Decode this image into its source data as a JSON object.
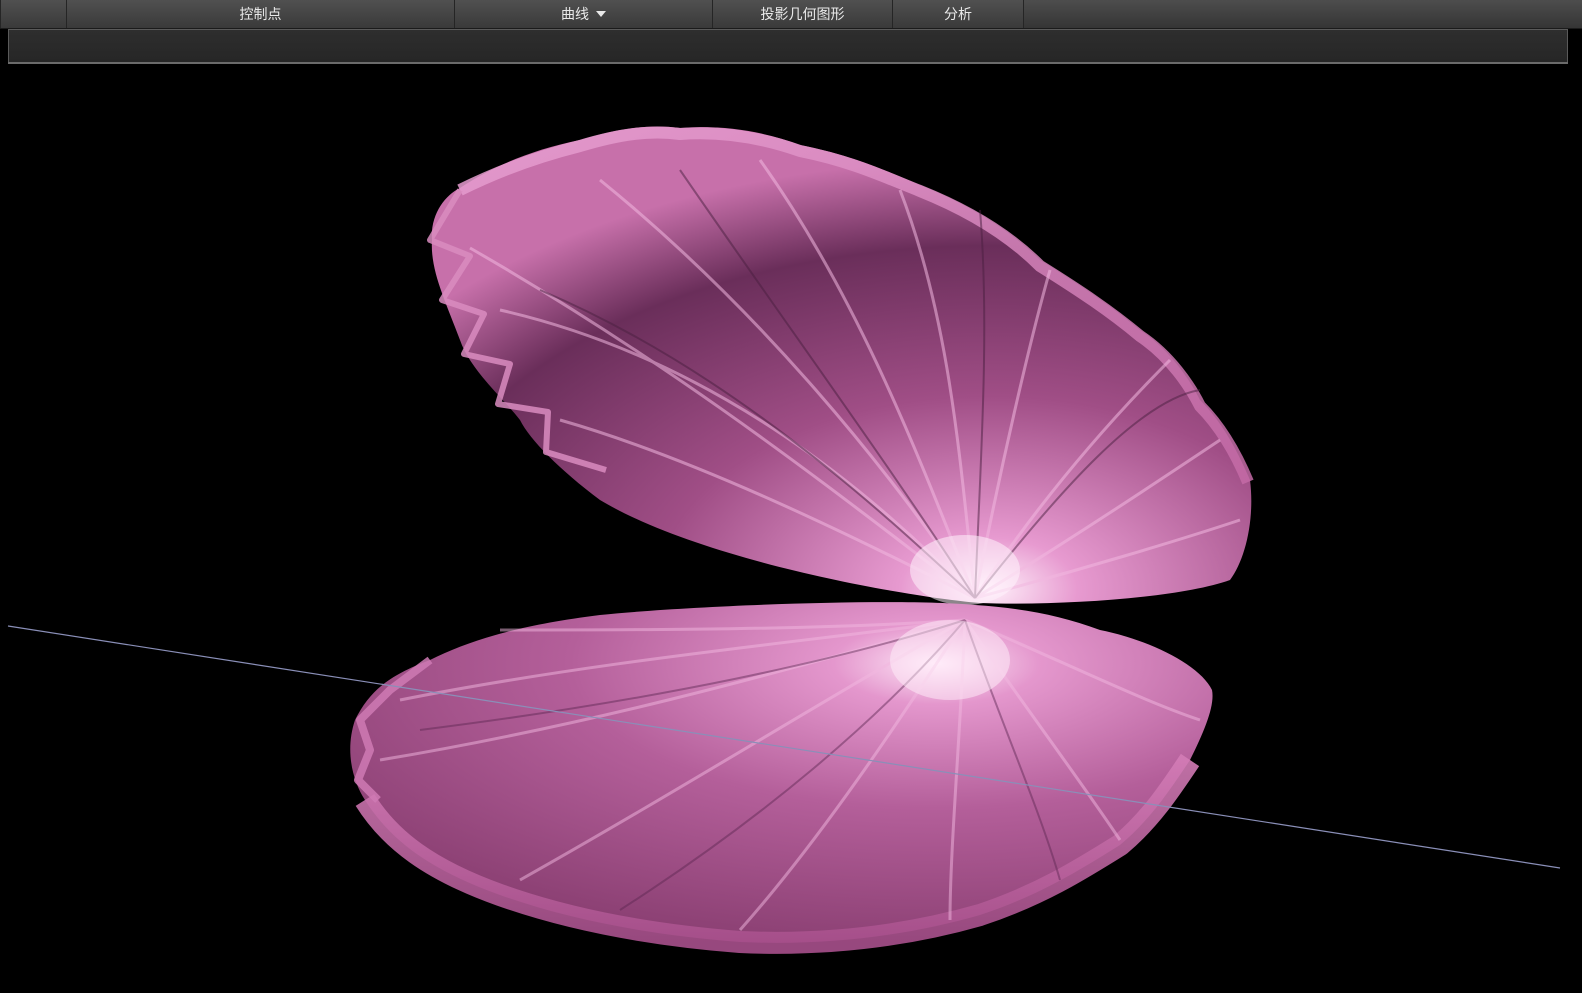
{
  "menu": {
    "tabs": [
      {
        "label": ""
      },
      {
        "label": "控制点"
      },
      {
        "label": "曲线",
        "has_dropdown": true
      },
      {
        "label": "投影几何图形"
      },
      {
        "label": "分析"
      }
    ]
  },
  "viewport": {
    "model": "scallop-shell",
    "shell_color": "#c86aa6",
    "background": "#000000"
  },
  "colors": {
    "accent": "#2f9c8a",
    "toolbar_bg": "#2a2a2a",
    "tab_text": "#e9e9e9",
    "axis_line": "#8a8fb8"
  }
}
